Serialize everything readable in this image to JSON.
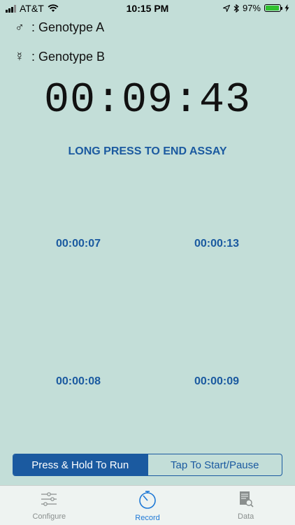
{
  "status_bar": {
    "carrier": "AT&T",
    "time": "10:15 PM",
    "battery": "97%",
    "battery_level": 0.97
  },
  "genotypes": {
    "male_symbol": "♂",
    "male_label": ": Genotype A",
    "hermaphrodite_symbol": "☿",
    "hermaphrodite_label": ":  Genotype B"
  },
  "main_timer": "00:09:43",
  "end_assay_label": "LONG PRESS TO END ASSAY",
  "sub_timers": [
    "00:00:07",
    "00:00:13",
    "00:00:08",
    "00:00:09"
  ],
  "mode_control": {
    "selected": "Press & Hold To Run",
    "other": "Tap To Start/Pause"
  },
  "tabs": [
    {
      "label": "Configure",
      "icon": "sliders-icon"
    },
    {
      "label": "Record",
      "icon": "stopwatch-icon"
    },
    {
      "label": "Data",
      "icon": "document-search-icon"
    }
  ],
  "active_tab": "Record",
  "colors": {
    "background": "#c3ded8",
    "accent": "#1b5aa0",
    "tab_active": "#1d78d6"
  }
}
